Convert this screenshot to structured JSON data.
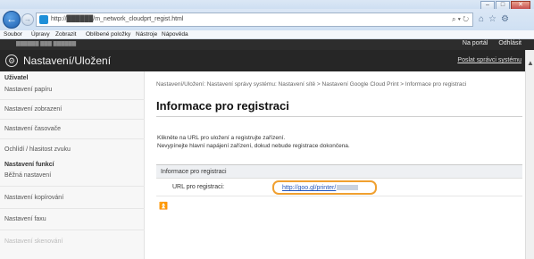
{
  "browser": {
    "url": "http://██████/m_network_cloudprt_regist.html",
    "url_tools": "⌕ ▾ ↻",
    "menu": [
      "Soubor",
      "Úpravy",
      "Zobrazit",
      "Oblíbené položky",
      "Nástroje",
      "Nápověda"
    ]
  },
  "header": {
    "model": "██████ ███ ██████",
    "portal_link": "Na portál",
    "logout_link": "Odhlásit",
    "title": "Nastavení/Uložení",
    "admin_link": "Poslat správci systému"
  },
  "sidebar": {
    "section1": "Uživatel",
    "items1": [
      "Nastavení papíru",
      "Nastavení zobrazení",
      "Nastavení časovače",
      "Ochlídí / hlasitost zvuku"
    ],
    "section2": "Nastavení funkcí",
    "items2": [
      "Běžná nastavení",
      "Nastavení kopírování",
      "Nastavení faxu",
      "Nastavení skenování"
    ]
  },
  "main": {
    "breadcrumb": "Nastavení/Uložení: Nastavení správy systému: Nastavení sítě > Nastavení Google Cloud Print > Informace pro registraci",
    "title": "Informace pro registraci",
    "desc1": "Klikněte na URL pro uložení a registrujte zařízení.",
    "desc2": "Nevypínejte hlavní napájení zařízení, dokud nebude registrace dokončena.",
    "table_header": "Informace pro registraci",
    "row_label": "URL pro registraci:",
    "row_value": "http://goo.gl/printer/",
    "top_link": "⏫"
  },
  "colors": {
    "highlight": "#f0a030",
    "header_bg": "#262626",
    "link": "#2255bb"
  },
  "icons": [
    "back-arrow-icon",
    "forward-arrow-icon",
    "page-icon",
    "home-icon",
    "star-icon",
    "gear-icon",
    "settings-circle-icon",
    "top-arrow-icon"
  ]
}
